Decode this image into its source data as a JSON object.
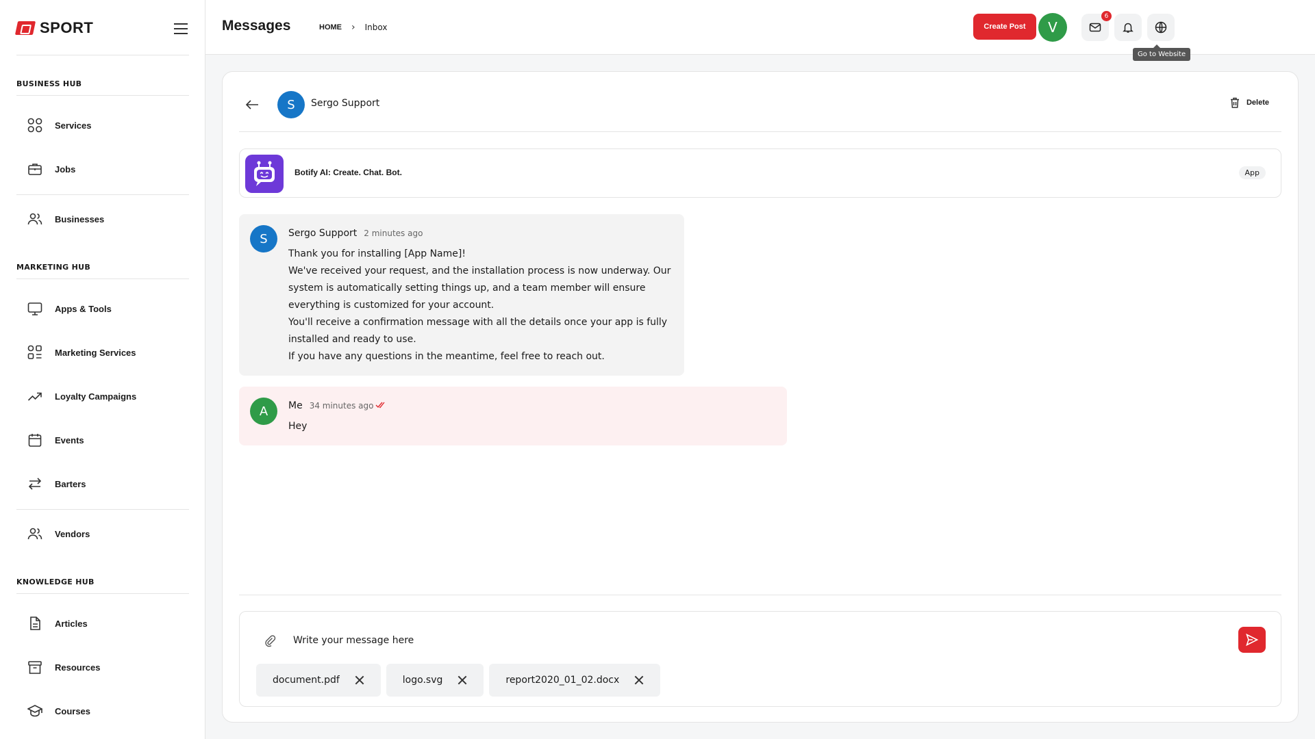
{
  "brand": {
    "logo_text": "SPORT",
    "accent": "#e0282e"
  },
  "sidebar": {
    "hubs": [
      {
        "title": "BUSINESS HUB",
        "items": [
          {
            "label": "Services",
            "icon": "grid-icon"
          },
          {
            "label": "Jobs",
            "icon": "briefcase-icon"
          },
          {
            "label": "Businesses",
            "icon": "users-icon"
          }
        ]
      },
      {
        "title": "MARKETING HUB",
        "items": [
          {
            "label": "Apps & Tools",
            "icon": "monitor-icon"
          },
          {
            "label": "Marketing Services",
            "icon": "grid-list-icon"
          },
          {
            "label": "Loyalty Campaigns",
            "icon": "trending-up-icon"
          },
          {
            "label": "Events",
            "icon": "calendar-icon"
          },
          {
            "label": "Barters",
            "icon": "swap-icon"
          },
          {
            "label": "Vendors",
            "icon": "users-icon"
          }
        ]
      },
      {
        "title": "KNOWLEDGE HUB",
        "items": [
          {
            "label": "Articles",
            "icon": "document-icon"
          },
          {
            "label": "Resources",
            "icon": "archive-icon"
          },
          {
            "label": "Courses",
            "icon": "graduation-cap-icon"
          }
        ]
      }
    ]
  },
  "header": {
    "title": "Messages",
    "breadcrumb": {
      "home": "HOME",
      "current": "Inbox"
    },
    "mail_badge": "6",
    "tooltip": "Go to Website",
    "create_label": "Create Post",
    "user_initial": "V"
  },
  "conversation": {
    "name": "Sergo Support",
    "initial": "S",
    "delete_label": "Delete",
    "app": {
      "name": "Botify AI: Create. Chat. Bot.",
      "tag": "App"
    }
  },
  "messages": [
    {
      "sender": "Sergo Support",
      "initial": "S",
      "time": "2 minutes ago",
      "avatar_color": "#1676c7",
      "lines": [
        "Thank you for installing [App Name]!",
        "We've received your request, and the installation process is now underway. Our system is automatically setting things up, and a team member will ensure everything is customized for your account.",
        "You'll receive a confirmation message with all the details once your app is fully installed and ready to use.",
        "If you have any questions in the meantime, feel free to reach out."
      ]
    },
    {
      "sender": "Me",
      "initial": "A",
      "time": "34 minutes ago",
      "avatar_color": "#2f9b48",
      "lines": [
        "Hey"
      ]
    }
  ],
  "composer": {
    "placeholder": "Write your message here",
    "attachments": [
      "document.pdf",
      "logo.svg",
      "report2020_01_02.docx"
    ]
  }
}
